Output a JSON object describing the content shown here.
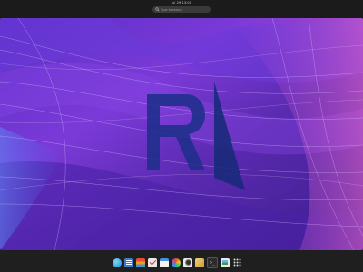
{
  "topbar": {
    "clock": "Jul 29 13:00",
    "search_placeholder": "Type to search"
  },
  "desktop": {
    "wallpaper": "abstract purple flowing lines with R logo",
    "logo_icon": "r-logo-icon"
  },
  "dock": {
    "apps": [
      {
        "name": "web-browser-icon",
        "color": "#2aa5d8"
      },
      {
        "name": "text-editor-icon",
        "color": "#3a7bd5"
      },
      {
        "name": "layers-app-icon",
        "color": "#e06b2b"
      },
      {
        "name": "tasks-app-icon",
        "color": "#e8e8e8"
      },
      {
        "name": "calendar-app-icon",
        "color": "#f2f2f2"
      },
      {
        "name": "color-palette-icon",
        "color": "#f0c419"
      },
      {
        "name": "camera-app-icon",
        "color": "#e9e9e9"
      },
      {
        "name": "package-app-icon",
        "color": "#e6c35a"
      },
      {
        "name": "terminal-app-icon",
        "color": "#2b2b2b"
      },
      {
        "name": "photo-viewer-icon",
        "color": "#eaeaea"
      },
      {
        "name": "app-grid-icon",
        "color": "#cfcfcf"
      }
    ]
  }
}
